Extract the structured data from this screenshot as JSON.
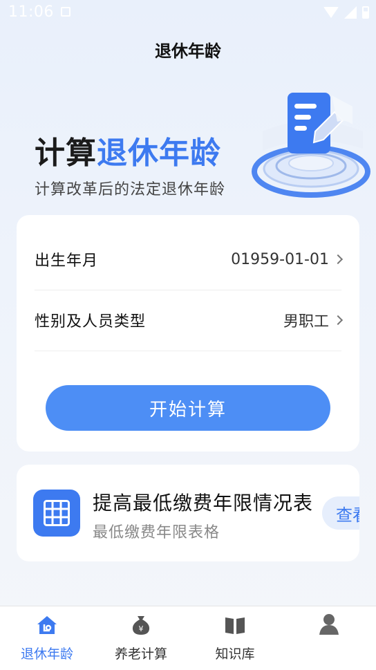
{
  "status_bar": {
    "time": "11:06"
  },
  "header": {
    "title": "退休年龄"
  },
  "hero": {
    "title_plain": "计算",
    "title_accent": "退休年龄",
    "subtitle": "计算改革后的法定退休年龄"
  },
  "form": {
    "rows": [
      {
        "label": "出生年月",
        "value": "01959-01-01"
      },
      {
        "label": "性别及人员类型",
        "value": "男职工"
      }
    ],
    "submit_label": "开始计算"
  },
  "info_card": {
    "title": "提高最低缴费年限情况表",
    "subtitle": "最低缴费年限表格",
    "button_label": "查看"
  },
  "bottom_nav": {
    "items": [
      {
        "label": "退休年龄",
        "icon": "house-icon",
        "active": true
      },
      {
        "label": "养老计算",
        "icon": "money-bag-icon",
        "active": false
      },
      {
        "label": "知识库",
        "icon": "book-icon",
        "active": false
      },
      {
        "label": "",
        "icon": "user-icon",
        "active": false
      }
    ]
  },
  "colors": {
    "accent": "#3d7af0",
    "button": "#4d8ef5",
    "background": "#eef3fb"
  }
}
